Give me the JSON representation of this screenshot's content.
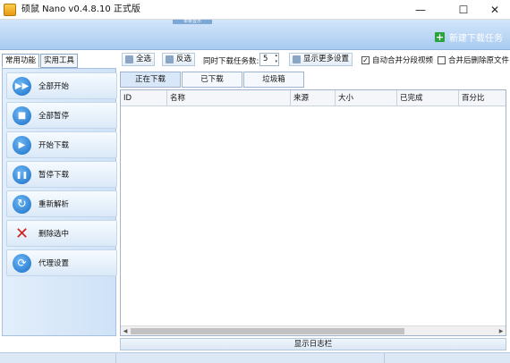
{
  "window": {
    "title": "硕鼠 Nano v0.4.8.10 正式版",
    "min_glyph": "—",
    "max_glyph": "☐",
    "close_glyph": "✕"
  },
  "banner": {
    "center_text": "单条显示",
    "new_task_label": "新建下载任务",
    "plus_glyph": "+"
  },
  "left_tabs": [
    "常用功能",
    "实用工具"
  ],
  "left_buttons": [
    {
      "label": "全部开始",
      "icon": "fast-forward-icon",
      "glyph": "▶▶"
    },
    {
      "label": "全部暂停",
      "icon": "stop-icon",
      "glyph": "■"
    },
    {
      "label": "开始下载",
      "icon": "play-icon",
      "glyph": "▶"
    },
    {
      "label": "暂停下载",
      "icon": "pause-icon",
      "glyph": "❚❚"
    },
    {
      "label": "重新解析",
      "icon": "refresh-icon",
      "glyph": "↻"
    },
    {
      "label": "删除选中",
      "icon": "delete-icon",
      "glyph": "✕"
    },
    {
      "label": "代理设置",
      "icon": "proxy-globe-icon",
      "glyph": "⟳"
    }
  ],
  "toolbar": {
    "select_all": "全选",
    "invert_select": "反选",
    "concurrent_label": "同时下载任务数:",
    "concurrent_value": "5",
    "more_settings": "显示更多设置",
    "auto_merge": {
      "label": "自动合并分段视频",
      "checked": true,
      "mark": "✓"
    },
    "delete_after_merge": {
      "label": "合并后删除原文件",
      "checked": false,
      "mark": ""
    }
  },
  "right_tabs": [
    "正在下载",
    "已下载",
    "垃圾箱"
  ],
  "table": {
    "columns": [
      "ID",
      "名称",
      "来源",
      "大小",
      "已完成",
      "百分比"
    ]
  },
  "scroll": {
    "left": "◀",
    "right": "▶"
  },
  "log_bar_label": "显示日志栏",
  "colors": {
    "accent": "#a8cbf0",
    "new_task_plus": "#29a43a",
    "delete_icon": "#d42020"
  }
}
